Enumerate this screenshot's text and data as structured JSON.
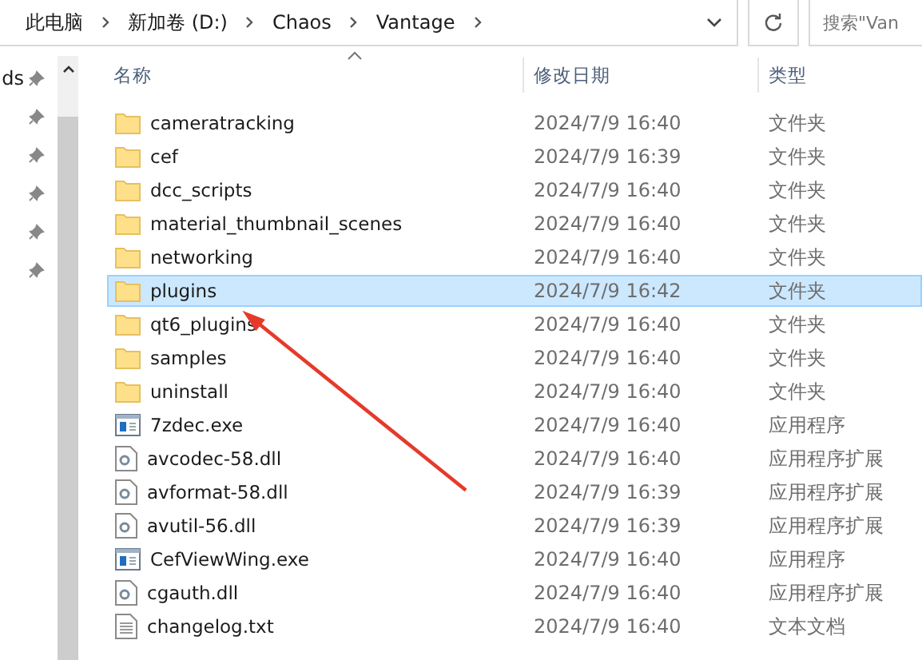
{
  "address_bar": {
    "crumbs": [
      "此电脑",
      "新加卷 (D:)",
      "Chaos",
      "Vantage"
    ],
    "search": {
      "placeholder": "搜索\"Van"
    }
  },
  "nav_pane": {
    "items": [
      {
        "label": "ds",
        "pinned": true
      },
      {
        "pinned": true
      },
      {
        "pinned": true
      },
      {
        "pinned": true
      },
      {
        "pinned": true
      },
      {
        "pinned": true
      }
    ]
  },
  "table": {
    "columns": [
      "名称",
      "修改日期",
      "类型"
    ],
    "rows": [
      {
        "kind": "folder",
        "name": "cameratracking",
        "date": "2024/7/9 16:40",
        "type": "文件夹",
        "selected": false
      },
      {
        "kind": "folder",
        "name": "cef",
        "date": "2024/7/9 16:39",
        "type": "文件夹",
        "selected": false
      },
      {
        "kind": "folder",
        "name": "dcc_scripts",
        "date": "2024/7/9 16:40",
        "type": "文件夹",
        "selected": false
      },
      {
        "kind": "folder",
        "name": "material_thumbnail_scenes",
        "date": "2024/7/9 16:40",
        "type": "文件夹",
        "selected": false
      },
      {
        "kind": "folder",
        "name": "networking",
        "date": "2024/7/9 16:40",
        "type": "文件夹",
        "selected": false
      },
      {
        "kind": "folder",
        "name": "plugins",
        "date": "2024/7/9 16:42",
        "type": "文件夹",
        "selected": true
      },
      {
        "kind": "folder",
        "name": "qt6_plugins",
        "date": "2024/7/9 16:40",
        "type": "文件夹",
        "selected": false
      },
      {
        "kind": "folder",
        "name": "samples",
        "date": "2024/7/9 16:40",
        "type": "文件夹",
        "selected": false
      },
      {
        "kind": "folder",
        "name": "uninstall",
        "date": "2024/7/9 16:40",
        "type": "文件夹",
        "selected": false
      },
      {
        "kind": "exe",
        "name": "7zdec.exe",
        "date": "2024/7/9 16:40",
        "type": "应用程序",
        "selected": false
      },
      {
        "kind": "dll",
        "name": "avcodec-58.dll",
        "date": "2024/7/9 16:40",
        "type": "应用程序扩展",
        "selected": false
      },
      {
        "kind": "dll",
        "name": "avformat-58.dll",
        "date": "2024/7/9 16:39",
        "type": "应用程序扩展",
        "selected": false
      },
      {
        "kind": "dll",
        "name": "avutil-56.dll",
        "date": "2024/7/9 16:39",
        "type": "应用程序扩展",
        "selected": false
      },
      {
        "kind": "exe",
        "name": "CefViewWing.exe",
        "date": "2024/7/9 16:40",
        "type": "应用程序",
        "selected": false
      },
      {
        "kind": "dll",
        "name": "cgauth.dll",
        "date": "2024/7/9 16:40",
        "type": "应用程序扩展",
        "selected": false
      },
      {
        "kind": "txt",
        "name": "changelog.txt",
        "date": "2024/7/9 16:40",
        "type": "文本文档",
        "selected": false
      }
    ]
  }
}
